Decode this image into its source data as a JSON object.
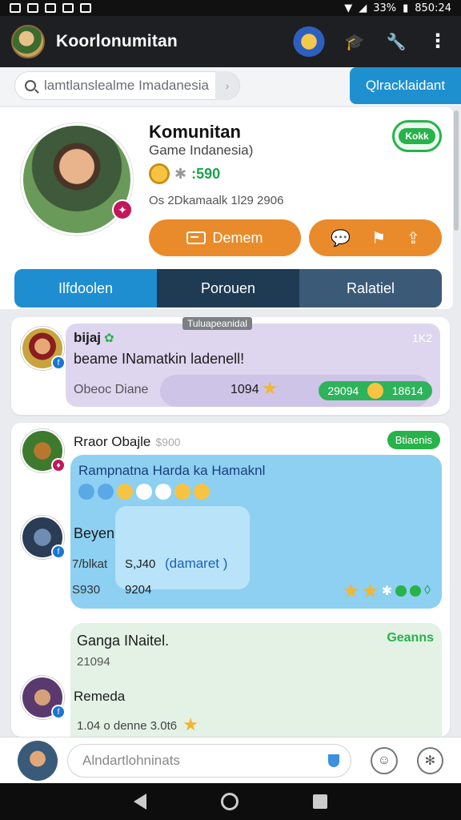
{
  "statusbar": {
    "battery": "33%",
    "time": "850:24"
  },
  "app": {
    "title": "Koorlonumitan"
  },
  "search": {
    "placeholder": "lamtlanslеalme Imadanesia",
    "quick_label": "Qlracklaidant"
  },
  "profile": {
    "name": "Komunitan",
    "subtitle": "Game Indanesia)",
    "score": ":590",
    "date": "Os 2Dkamaalk 1l29 2906",
    "status_badge": "Kokk",
    "primary_button": "Demem",
    "tabs": [
      "Ilfdoolen",
      "Porouen",
      "Ralatiel"
    ]
  },
  "feed": {
    "section_label": "Tuluapeanidal",
    "post1": {
      "author": "bijaj",
      "text": "beame INamatkin ladenell!",
      "time": "1K2",
      "footer": "Obeoc Diane",
      "count": "1094",
      "pill_left": "29094",
      "pill_right": "18614"
    },
    "post2": {
      "author": "Rraor Obajle",
      "author_meta": "$900",
      "tag": "Btiaenis",
      "message": "Rampnatna Harda ka Hamaknl",
      "reply_author": "Beyen",
      "small1": "7/blkat",
      "small2": "S930",
      "value1": "S,J40",
      "value2": "9204",
      "link": "(damaret )",
      "section2_title": "Ganga INaitel.",
      "section2_tag": "Geanns",
      "section2_num": "21094",
      "reply2_author": "Remeda",
      "footer": "1.04 o denne  3.0t6"
    }
  },
  "composer": {
    "placeholder": "Alndartlohninats"
  },
  "colors": {
    "accent_blue": "#1e8ed0",
    "orange": "#e98b2a",
    "green": "#27b24a",
    "dark": "#1e1f22"
  }
}
